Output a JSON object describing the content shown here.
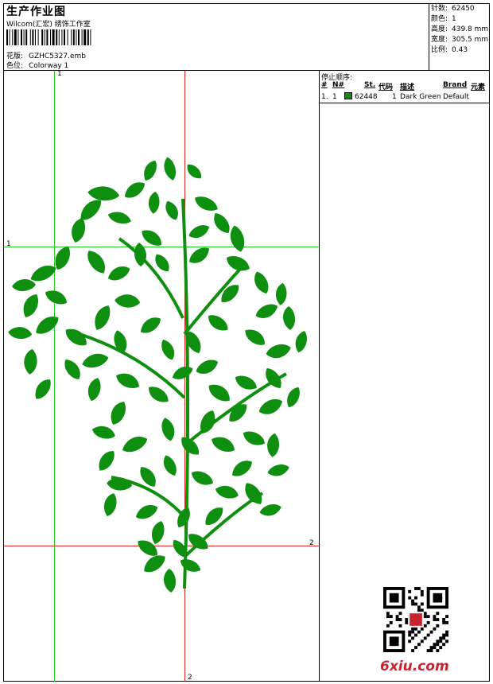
{
  "header": {
    "title": "生产作业图",
    "subtitle": "Wilcom(汇宏) 绣饰工作室",
    "design_label": "花版:",
    "design_value": "GZHC5327.emb",
    "colorway_label": "色位:",
    "colorway_value": "Colorway 1"
  },
  "stats": [
    {
      "label": "针数:",
      "value": "62450"
    },
    {
      "label": "颜色:",
      "value": "1"
    },
    {
      "label": "高度:",
      "value": "439.8 mm"
    },
    {
      "label": "宽度:",
      "value": "305.5 mm"
    },
    {
      "label": "比例:",
      "value": "0.43"
    }
  ],
  "stop_sequence": {
    "title": "停止顺序:",
    "headers": {
      "num": "#",
      "n": "N#",
      "st": "St.",
      "code": "代码",
      "desc": "描述",
      "brand": "Brand",
      "element": "元素"
    },
    "rows": [
      {
        "num": "1.",
        "n": "1",
        "st": "62448",
        "code": "1",
        "desc": "Dark Green",
        "brand": "Default",
        "color": "#0f8f0f"
      }
    ]
  },
  "guides": {
    "green_v": "1",
    "green_h": "1",
    "red_h": "2",
    "red_v": "2"
  },
  "colors": {
    "thread": "#0f8f0f",
    "guide_green": "#22cc22",
    "guide_red": "#dd2222",
    "brand_red": "#c9232f"
  },
  "watermark": {
    "logo": "6xiu.com"
  }
}
